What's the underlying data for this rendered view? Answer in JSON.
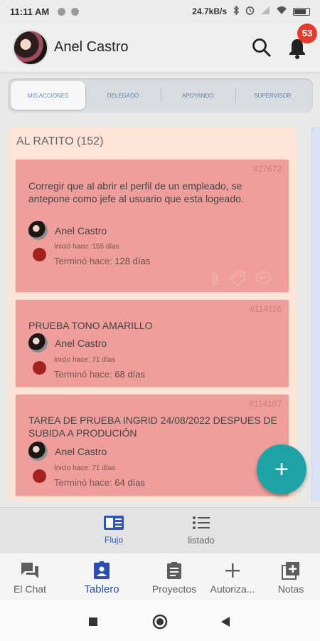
{
  "status_bar": {
    "time": "11:11 AM",
    "net_speed": "24.7kB/s",
    "colors": {
      "icon": "#555555"
    }
  },
  "app_bar": {
    "user_name": "Anel Castro",
    "notification_count": "53",
    "icons": [
      "avatar",
      "search-icon",
      "bell-icon"
    ]
  },
  "segments": [
    {
      "label": "MIS ACCIONES",
      "active": true
    },
    {
      "label": "DELEGADO",
      "active": false
    },
    {
      "label": "APOYANDO",
      "active": false
    },
    {
      "label": "SUPERVISOR",
      "active": false
    }
  ],
  "column": {
    "title": "AL RATITO (152)",
    "color": "#fde4d7"
  },
  "cards": [
    {
      "id": "#27672",
      "title": "Corregir que al abrir el perfil de un empleado, se antepone como jefe al usuario que esta logeado.",
      "owner": "Anel Castro",
      "started": "Inició hace: 155 días",
      "ended_prefix": "Terminó hace:",
      "ended_value": "128 días",
      "icons": [
        "paperclip-icon",
        "tag-icon",
        "chat-bubble-icon"
      ]
    },
    {
      "id": "#114116",
      "title": "PRUEBA TONO AMARILLO",
      "owner": "Anel Castro",
      "started": "Inicio hace: 71 días",
      "ended_prefix": "Terminó hace:",
      "ended_value": "68 días"
    },
    {
      "id": "#114107",
      "title": "TAREA DE PRUEBA INGRID 24/08/2022 DESPUES DE SUBIDA A PRODUCIÓN",
      "owner": "Anel Castro",
      "started": "Inicio hace: 71 días",
      "ended_prefix": "Terminó hace:",
      "ended_value": "64 días"
    }
  ],
  "fab": {
    "label": "+"
  },
  "view_switch": [
    {
      "label": "Flujo",
      "active": true,
      "icon": "board-view-icon"
    },
    {
      "label": "listado",
      "active": false,
      "icon": "list-view-icon"
    }
  ],
  "bottom_nav": [
    {
      "label": "El Chat",
      "icon": "chat-icon",
      "active": false
    },
    {
      "label": "Tablero",
      "icon": "badge-icon",
      "active": true
    },
    {
      "label": "Proyectos",
      "icon": "clipboard-icon",
      "active": false
    },
    {
      "label": "Autoriza...",
      "icon": "plus-icon",
      "active": false
    },
    {
      "label": "Notas",
      "icon": "add-note-icon",
      "active": false
    }
  ],
  "theme": {
    "card": "#ef9e9b",
    "status_dot": "#a3221f",
    "fab": "#20a3a6",
    "active_nav": "#2b4fb0",
    "badge": "#e8392e"
  }
}
